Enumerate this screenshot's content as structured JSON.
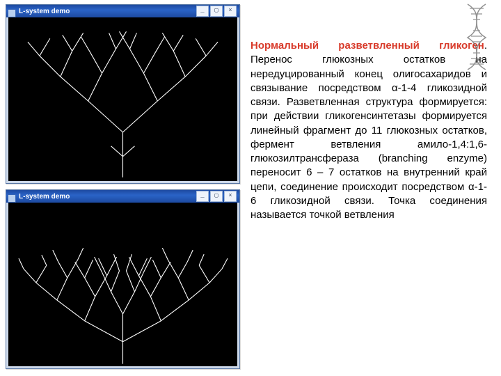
{
  "windows": {
    "top": {
      "title": "L-system demo",
      "btn_min": "_",
      "btn_max": "▢",
      "btn_close": "×"
    },
    "bot": {
      "title": "L-system demo",
      "btn_min": "_",
      "btn_max": "▢",
      "btn_close": "×"
    }
  },
  "text": {
    "highlight": "Нормальный разветвленный гликоген",
    "body": ". Перенос глюкозных остатков на нередуцированный конец олигосахаридов и связывание посредством α-1-4 гликозидной связи. Разветвленная структура формируется: при действии гликогенсинтетазы формируется линейный фрагмент до 11 глюкозных остатков, фермент ветвления амило-1,4:1,6-глюкозилтрансфераза (branching enzyme) переносит 6 – 7 остатков на внутренний край цепи, соединение происходит посредством α-1-6 гликозидной связи. Точка соединения называется точкой ветвления"
  }
}
